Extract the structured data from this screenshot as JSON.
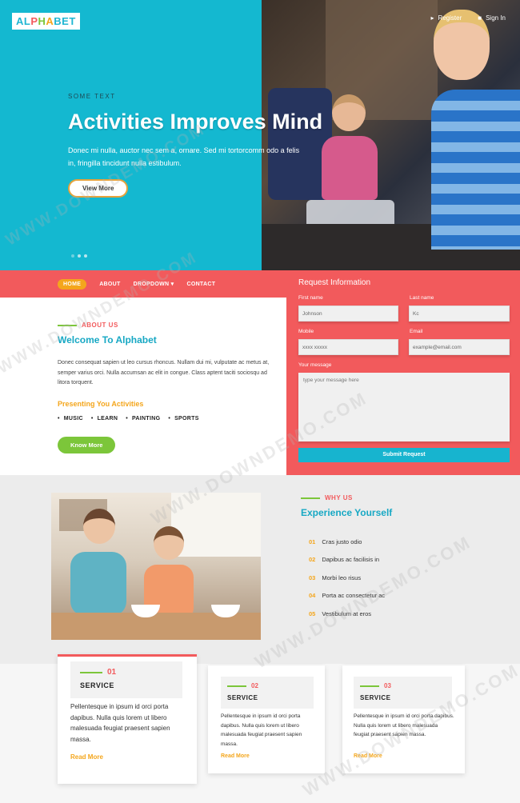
{
  "header": {
    "logo_letters": [
      {
        "ch": "AL",
        "color": "#1fb6d2"
      },
      {
        "ch": "P",
        "color": "#f25a5c"
      },
      {
        "ch": "H",
        "color": "#7cc63a"
      },
      {
        "ch": "A",
        "color": "#f4a61c"
      },
      {
        "ch": "BET",
        "color": "#1fb6d2"
      }
    ],
    "register": "Register",
    "signin": "Sign In"
  },
  "hero": {
    "subtitle": "SOME TEXT",
    "title": "Activities Improves Mind",
    "description": "Donec mi nulla, auctor nec sem a, ornare. Sed mi tortorcomm odo a felis in, fringilla tincidunt nulla estibulum.",
    "button": "View More"
  },
  "nav": [
    "HOME",
    "ABOUT",
    "DROPDOWN",
    "CONTACT"
  ],
  "about": {
    "label": "ABOUT US",
    "title": "Welcome To Alphabet",
    "description": "Donec consequat sapien ut leo cursus rhoncus. Nullam dui mi, vulputate ac metus at, semper varius orci. Nulla accumsan ac elit in congue. Class aptent taciti sociosqu ad litora torquent.",
    "presenting": "Presenting You Activities",
    "activities": [
      "MUSIC",
      "LEARN",
      "PAINTING",
      "SPORTS"
    ],
    "button": "Know More"
  },
  "request": {
    "title": "Request Information",
    "first_label": "First name",
    "first_value": "Johnson",
    "last_label": "Last name",
    "last_value": "Kc",
    "mobile_label": "Mobile",
    "mobile_placeholder": "xxxx xxxxx",
    "email_label": "Email",
    "email_placeholder": "example@email.com",
    "message_label": "Your message",
    "message_placeholder": "type your message here",
    "submit": "Submit Request"
  },
  "why": {
    "label": "WHY US",
    "title": "Experience Yourself",
    "items": [
      {
        "num": "01",
        "text": "Cras justo odio"
      },
      {
        "num": "02",
        "text": "Dapibus ac facilisis in"
      },
      {
        "num": "03",
        "text": "Morbi leo risus"
      },
      {
        "num": "04",
        "text": "Porta ac consectetur ac"
      },
      {
        "num": "05",
        "text": "Vestibulum at eros"
      }
    ]
  },
  "services": [
    {
      "num": "01",
      "title": "SERVICE",
      "text": "Pellentesque in ipsum id orci porta dapibus. Nulla quis lorem ut libero malesuada feugiat praesent sapien massa.",
      "more": "Read More"
    },
    {
      "num": "02",
      "title": "SERVICE",
      "text": "Pellentesque in ipsum id orci porta dapibus. Nulla quis lorem ut libero malesuada feugiat praesent sapien massa.",
      "more": "Read More"
    },
    {
      "num": "03",
      "title": "SERVICE",
      "text": "Pellentesque in ipsum id orci porta dapibus. Nulla quis lorem ut libero malesuada feugiat praesent sapien massa.",
      "more": "Read More"
    }
  ],
  "watermark": "WWW.DOWNDEMO.COM",
  "colors": {
    "cyan": "#14b8d0",
    "coral": "#f25a5c",
    "orange": "#f4a61c",
    "green": "#7cc63a"
  }
}
